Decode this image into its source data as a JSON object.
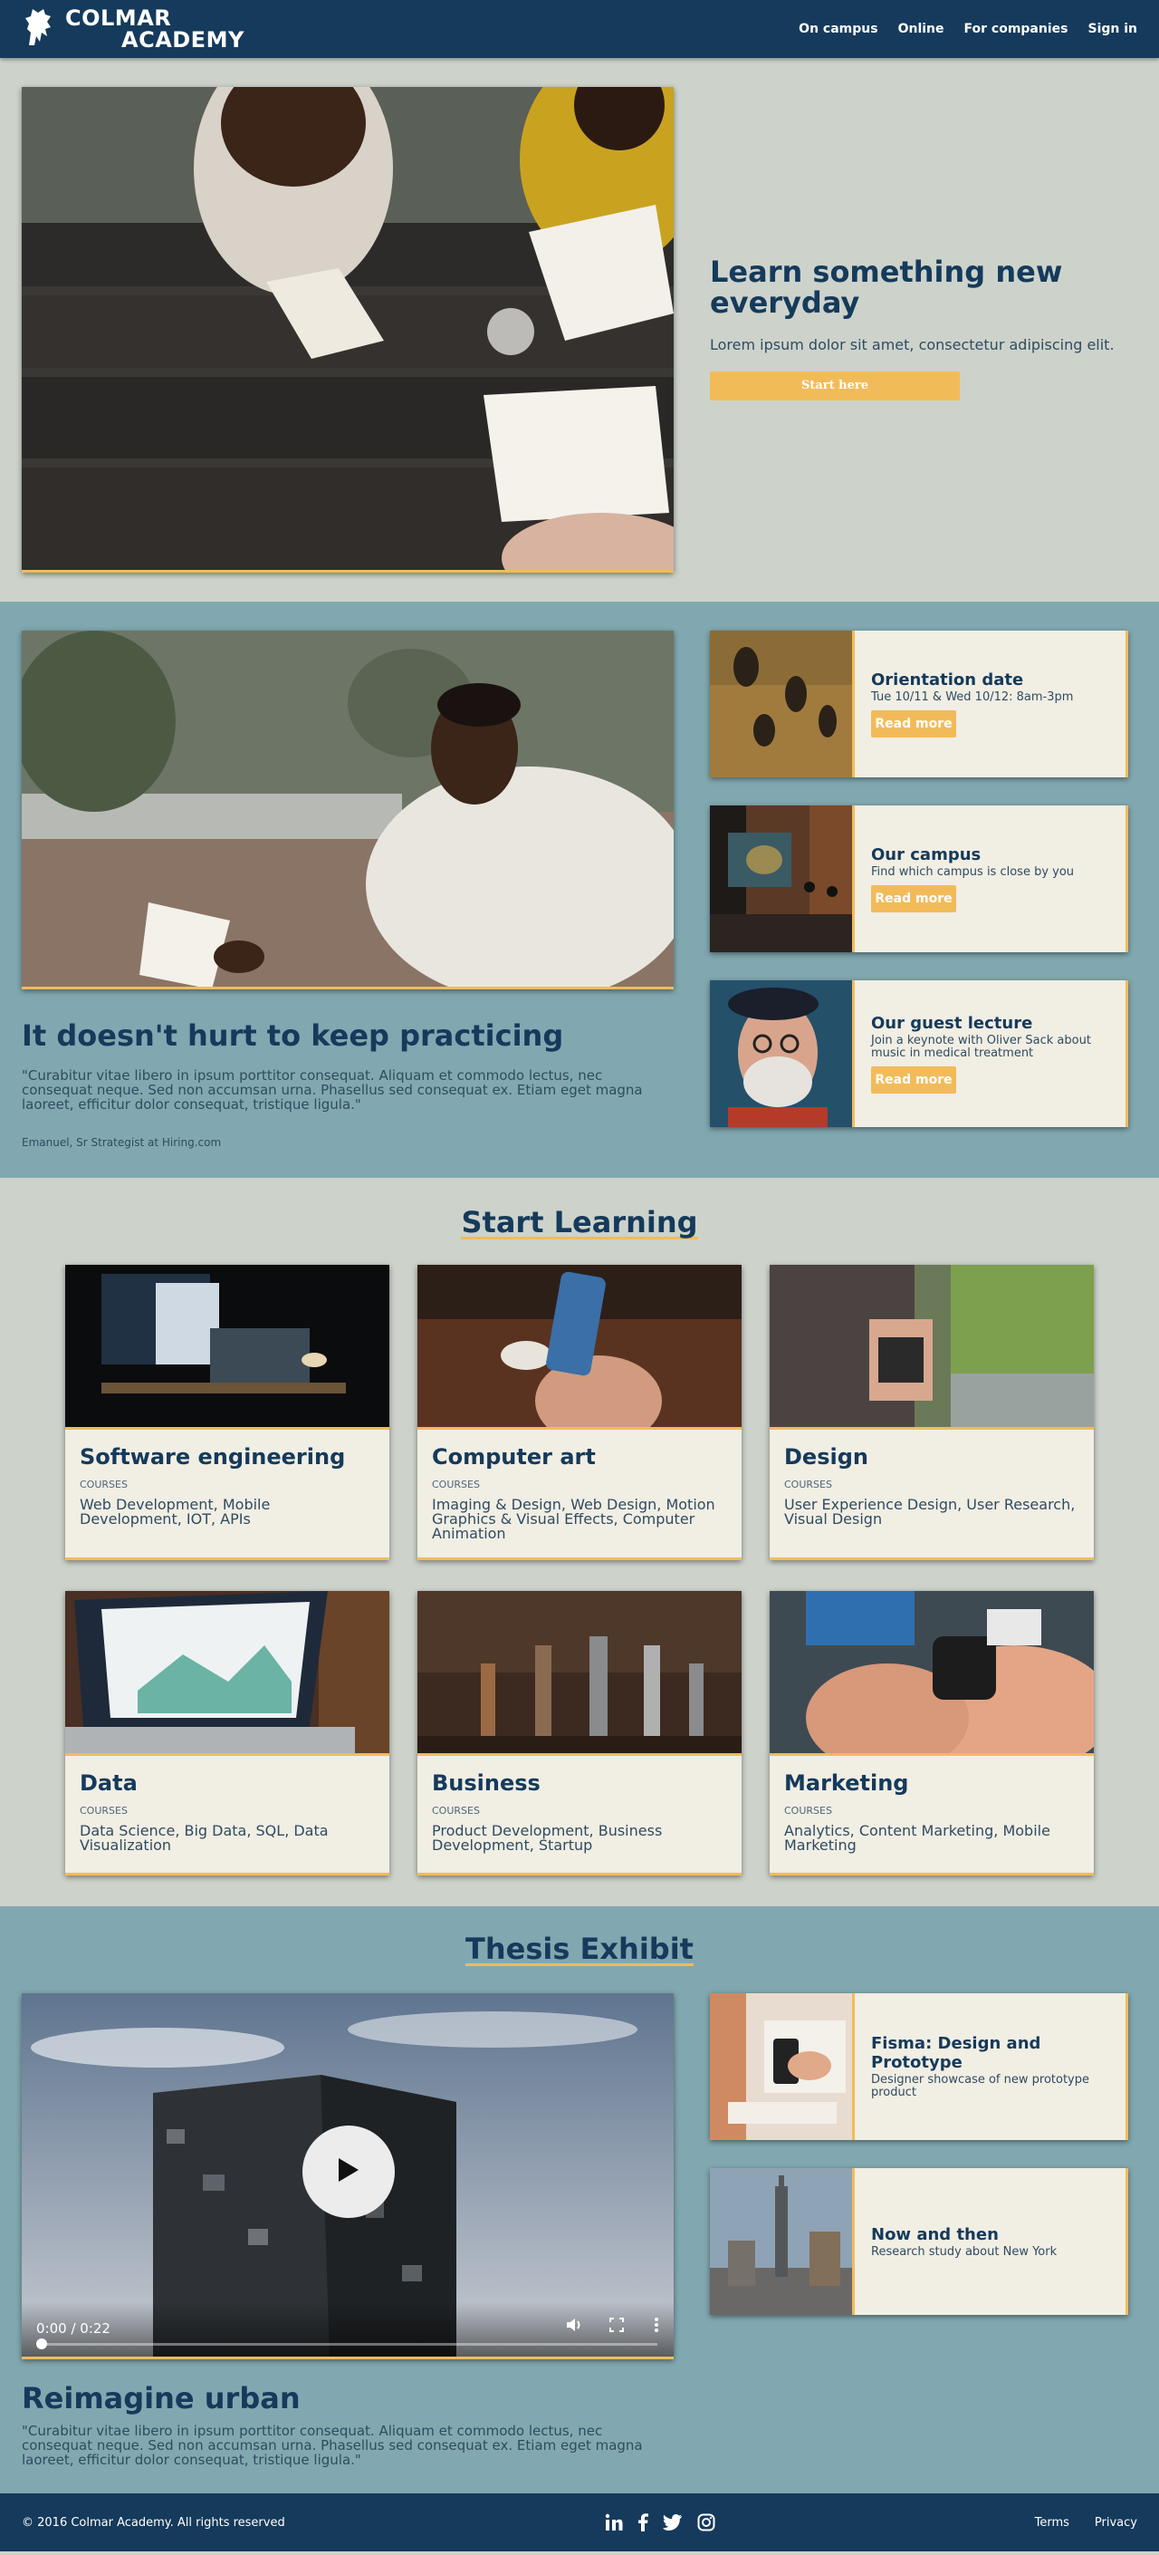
{
  "header": {
    "logo_line1": "COLMAR",
    "logo_line2": "ACADEMY",
    "nav": [
      "On campus",
      "Online",
      "For companies",
      "Sign in"
    ]
  },
  "hero": {
    "title": "Learn something new everyday",
    "subtitle": "Lorem ipsum dolor sit amet, consectetur adipiscing elit.",
    "button": "Start here"
  },
  "practice": {
    "title": "It doesn't hurt to keep practicing",
    "quote": "\"Curabitur vitae libero in ipsum porttitor consequat. Aliquam et commodo lectus, nec consequat neque. Sed non accumsan urna. Phasellus sed consequat ex. Etiam eget magna laoreet, efficitur dolor consequat, tristique ligula.\"",
    "author": "Emanuel, Sr Strategist at Hiring.com"
  },
  "events": [
    {
      "title": "Orientation date",
      "desc": "Tue 10/11 & Wed 10/12: 8am-3pm",
      "button": "Read more"
    },
    {
      "title": "Our campus",
      "desc": "Find which campus is close by you",
      "button": "Read more"
    },
    {
      "title": "Our guest lecture",
      "desc": "Join a keynote with Oliver Sack about music in medical treatment",
      "button": "Read more"
    }
  ],
  "learning": {
    "title": "Start Learning",
    "courses": [
      {
        "title": "Software engineering",
        "kicker": "COURSES",
        "list": "Web Development, Mobile Development, IOT, APIs"
      },
      {
        "title": "Computer art",
        "kicker": "COURSES",
        "list": "Imaging & Design, Web Design, Motion Graphics & Visual Effects, Computer Animation"
      },
      {
        "title": "Design",
        "kicker": "COURSES",
        "list": "User Experience Design, User Research, Visual Design"
      },
      {
        "title": "Data",
        "kicker": "COURSES",
        "list": "Data Science, Big Data, SQL, Data Visualization"
      },
      {
        "title": "Business",
        "kicker": "COURSES",
        "list": "Product Development, Business Development, Startup"
      },
      {
        "title": "Marketing",
        "kicker": "COURSES",
        "list": "Analytics, Content Marketing, Mobile Marketing"
      }
    ]
  },
  "thesis": {
    "title": "Thesis Exhibit",
    "video_time": "0:00 / 0:22",
    "video_progress": 0.0,
    "projects": [
      {
        "title": "Fisma: Design and Prototype",
        "desc": "Designer showcase of new prototype product"
      },
      {
        "title": "Now and then",
        "desc": "Research study about New York"
      }
    ],
    "subtitle": "Reimagine urban",
    "quote": "\"Curabitur vitae libero in ipsum porttitor consequat. Aliquam et commodo lectus, nec consequat neque. Sed non accumsan urna. Phasellus sed consequat ex. Etiam eget magna laoreet, efficitur dolor consequat, tristique ligula.\""
  },
  "footer": {
    "copyright": "© 2016 Colmar Academy. All rights reserved",
    "social_icons": [
      "linkedin-icon",
      "facebook-icon",
      "twitter-icon",
      "instagram-icon"
    ],
    "links": [
      "Terms",
      "Privacy"
    ]
  },
  "colors": {
    "navy": "#153a5b",
    "accent": "#f2bb5a",
    "teal_bg": "#81a8b0",
    "sage_bg": "#cdd3cb",
    "card_bg": "#f1eee4"
  }
}
